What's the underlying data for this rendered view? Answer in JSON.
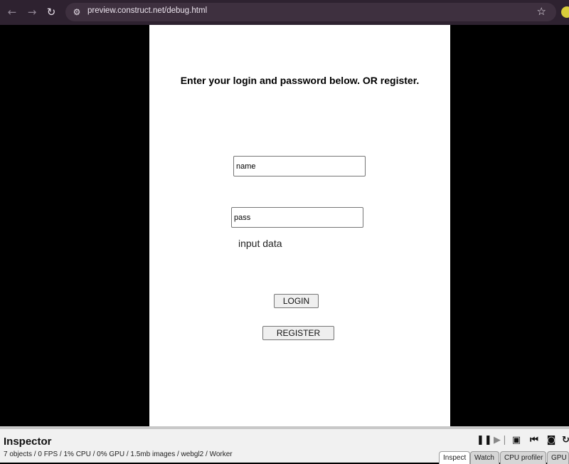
{
  "browser": {
    "url": "preview.construct.net/debug.html",
    "icons": {
      "back": "arrow-left-icon",
      "forward": "arrow-right-icon",
      "reload": "reload-icon",
      "site_info": "tune-icon",
      "bookmark": "star-icon",
      "extension": "extension-icon"
    }
  },
  "game": {
    "heading": "Enter your login and password below. OR register.",
    "name_field": {
      "value": "name"
    },
    "pass_field": {
      "value": "pass"
    },
    "input_label": "input data",
    "login_label": "LOGIN",
    "register_label": "REGISTER"
  },
  "inspector": {
    "title": "Inspector",
    "stats": "7 objects / 0 FPS / 1% CPU / 0% GPU / 1.5mb images / webgl2 / Worker",
    "toolbar_icons": [
      "pause-icon",
      "step-icon",
      "save-icon",
      "restart-icon",
      "camera-icon",
      "refresh-icon"
    ],
    "tabs": [
      "Inspect",
      "Watch",
      "CPU profiler",
      "GPU profiler"
    ],
    "active_tab": "Inspect"
  },
  "colors": {
    "chrome_bg": "#2e2230",
    "omnibox_bg": "#3e303f",
    "canvas_bg": "#ffffff",
    "letterbox": "#000000",
    "inspector_bg": "#f1f1f1"
  }
}
